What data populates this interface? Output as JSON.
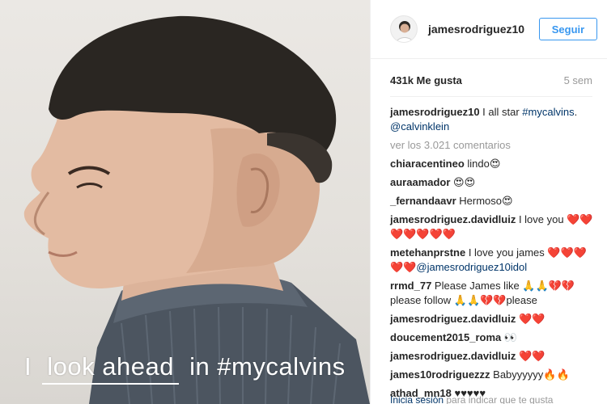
{
  "photo": {
    "caption_words": [
      "I",
      "look ahead",
      "in #mycalvins"
    ]
  },
  "header": {
    "username": "jamesrodriguez10",
    "follow_label": "Seguir"
  },
  "stats": {
    "likes": "431k Me gusta",
    "time": "5 sem"
  },
  "caption": {
    "username": "jamesrodriguez10",
    "text": " I all star ",
    "hashtag": "#mycalvins",
    "mention": "@calvinklein"
  },
  "more_comments": "ver los 3.021 comentarios",
  "comments": [
    {
      "user": "chiaracentineo",
      "text": " lindo😍"
    },
    {
      "user": "auraamador",
      "text": " 😍😍"
    },
    {
      "user": "_fernandaavr",
      "text": " Hermoso😍"
    },
    {
      "user": "jamesrodriguez.davidluiz",
      "text": " I love you ❤️❤️❤️❤️❤️❤️❤️"
    },
    {
      "user": "metehanprstne",
      "text": " I love you james ❤️❤️❤️❤️❤️",
      "mention": "@jamesrodriguez10idol"
    },
    {
      "user": "rrmd_77",
      "text": " Please James like 🙏🙏💔💔 please follow 🙏🙏💔💔please"
    },
    {
      "user": "jamesrodriguez.davidluiz",
      "text": " ❤️❤️"
    },
    {
      "user": "doucement2015_roma",
      "text": " 👀"
    },
    {
      "user": "jamesrodriguez.davidluiz",
      "text": " ❤️❤️"
    },
    {
      "user": "james10rodriguezzz",
      "text": " Babyyyyyy🔥🔥"
    },
    {
      "user": "athad_mn18",
      "text": " ♥♥♥♥♥"
    }
  ],
  "footer": {
    "login_link": "Inicia sesión",
    "login_text": " para indicar que te gusta"
  }
}
